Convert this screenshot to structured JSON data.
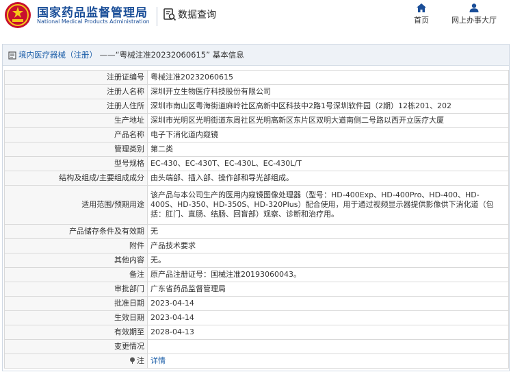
{
  "header": {
    "title": "国家药品监督管理局",
    "subtitle": "National Medical Products Administration",
    "query_label": "数据查询",
    "nav": [
      {
        "label": "首页",
        "icon": "home-icon"
      },
      {
        "label": "网上办事大厅",
        "icon": "user-icon"
      }
    ],
    "brand_color": "#1a4e98"
  },
  "breadcrumb": {
    "category": "境内医疗器械（注册）",
    "separator": "——",
    "current": "“粤械注准20232060615”",
    "suffix": "基本信息"
  },
  "record": {
    "rows": [
      {
        "label": "注册证编号",
        "value": "粤械注准20232060615"
      },
      {
        "label": "注册人名称",
        "value": "深圳开立生物医疗科技股份有限公司"
      },
      {
        "label": "注册人住所",
        "value": "深圳市南山区粤海街道麻岭社区高新中区科技中2路1号深圳软件园（2期）12栋201、202"
      },
      {
        "label": "生产地址",
        "value": "深圳市光明区光明街道东周社区光明高新区东片区双明大道南侧二号路以西开立医疗大厦"
      },
      {
        "label": "产品名称",
        "value": "电子下消化道内窥镜"
      },
      {
        "label": "管理类别",
        "value": "第二类"
      },
      {
        "label": "型号规格",
        "value": "EC-430、EC-430T、EC-430L、EC-430L/T"
      },
      {
        "label": "结构及组成/主要组成成分",
        "value": "由头端部、插入部、操作部和导光部组成。"
      },
      {
        "label": "适用范围/预期用途",
        "value": "该产品与本公司生产的医用内窥镜图像处理器（型号：HD-400Exp、HD-400Pro、HD-400、HD-400S、HD-350、HD-350S、HD-320Plus）配合使用，用于通过视频显示器提供影像供下消化道（包括：肛门、直肠、结肠、回盲部）观察、诊断和治疗用。"
      },
      {
        "label": "产品储存条件及有效期",
        "value": "无"
      },
      {
        "label": "附件",
        "value": "产品技术要求"
      },
      {
        "label": "其他内容",
        "value": "无。"
      },
      {
        "label": "备注",
        "value": "原产品注册证号：国械注准20193060043。"
      },
      {
        "label": "审批部门",
        "value": "广东省药品监督管理局"
      },
      {
        "label": "批准日期",
        "value": "2023-04-14"
      },
      {
        "label": "生效日期",
        "value": "2023-04-14"
      },
      {
        "label": "有效期至",
        "value": "2028-04-13"
      },
      {
        "label": "变更情况",
        "value": ""
      }
    ],
    "note_label": "注",
    "note_link": "详情"
  }
}
